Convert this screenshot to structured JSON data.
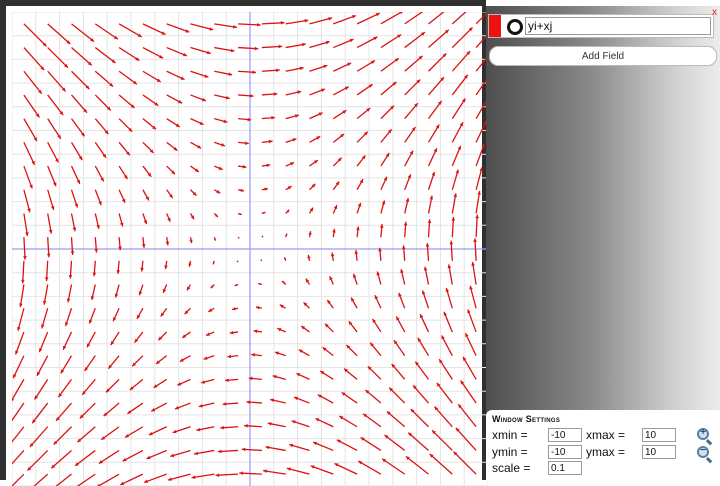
{
  "field_panel": {
    "expression_value": "yi+xj",
    "close_label": "x",
    "field_color": "#ee1111"
  },
  "add_field_label": "Add Field",
  "window_settings": {
    "title": "Window Settings",
    "xmin_label": "xmin =",
    "xmin_value": "-10",
    "xmax_label": "xmax =",
    "xmax_value": "10",
    "ymin_label": "ymin =",
    "ymin_value": "-10",
    "ymax_label": "ymax =",
    "ymax_value": "10",
    "scale_label": "scale =",
    "scale_value": "0.1"
  },
  "zoom_in_symbol": "+",
  "zoom_out_symbol": "−",
  "colors": {
    "arrow": "#dd1111",
    "axis": "#9a9af2",
    "grid": "#e4e4e4"
  },
  "chart_data": {
    "type": "vector-field",
    "field": "yi+xj",
    "xlim": [
      -10,
      10
    ],
    "ylim": [
      -10,
      10
    ],
    "scale": 0.1,
    "grid_step": 1,
    "grid": true
  }
}
